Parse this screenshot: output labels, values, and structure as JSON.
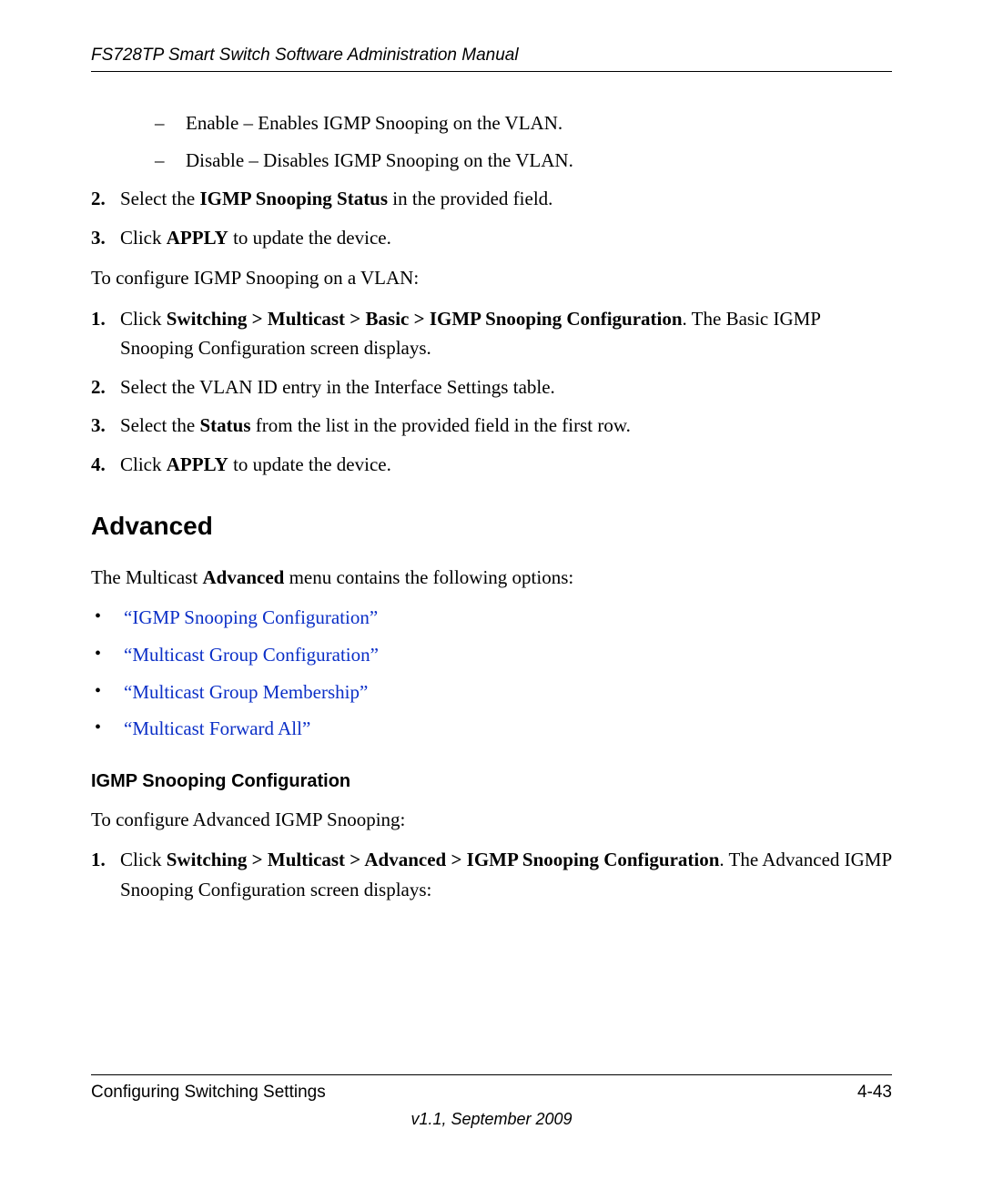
{
  "header": {
    "running_title": "FS728TP Smart Switch Software Administration Manual"
  },
  "dash_items": [
    "Enable – Enables IGMP Snooping on the VLAN.",
    "Disable – Disables IGMP Snooping on the VLAN."
  ],
  "steps_a": {
    "s2_pre": "Select the ",
    "s2_bold": "IGMP Snooping Status",
    "s2_post": " in the provided field.",
    "s3_pre": "Click ",
    "s3_bold": "APPLY",
    "s3_post": " to update the device."
  },
  "para_configure_vlan": "To configure IGMP Snooping on a VLAN:",
  "steps_b": {
    "s1_pre": "Click ",
    "s1_bold": "Switching > Multicast > Basic > IGMP Snooping Configuration",
    "s1_post": ". The Basic IGMP Snooping Configuration screen displays.",
    "s2": "Select the VLAN ID entry in the Interface Settings table.",
    "s3_pre": "Select the ",
    "s3_bold": "Status",
    "s3_post": " from the list in the provided field in the first row.",
    "s4_pre": "Click ",
    "s4_bold": "APPLY",
    "s4_post": " to update the device."
  },
  "advanced": {
    "heading": "Advanced",
    "intro_pre": "The Multicast ",
    "intro_bold": "Advanced",
    "intro_post": " menu contains the following options:",
    "links": [
      "“IGMP Snooping Configuration”",
      "“Multicast Group Configuration”",
      "“Multicast Group Membership”",
      "“Multicast Forward All”"
    ],
    "sub_heading": "IGMP Snooping Configuration",
    "sub_intro": "To configure Advanced IGMP Snooping:",
    "sub_step1_pre": "Click ",
    "sub_step1_bold": "Switching > Multicast > Advanced > IGMP Snooping Configuration",
    "sub_step1_post": ". The Advanced IGMP Snooping Configuration screen displays:"
  },
  "footer": {
    "section": "Configuring Switching Settings",
    "page": "4-43",
    "version": "v1.1, September 2009"
  }
}
